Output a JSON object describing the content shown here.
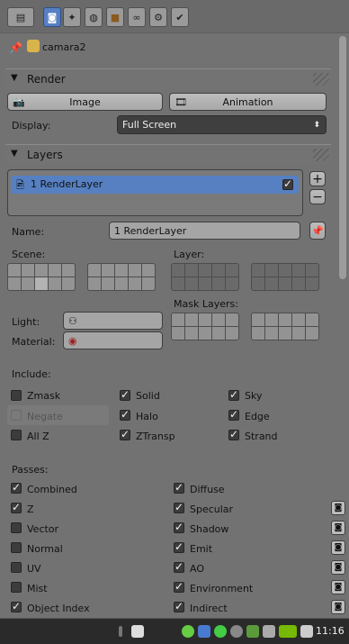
{
  "header": {
    "tabs": [
      {
        "icon": "editor-type-icon",
        "glyph": "▤"
      },
      {
        "icon": "camera-icon",
        "glyph": "◙"
      },
      {
        "icon": "scene-icon",
        "glyph": "✦"
      },
      {
        "icon": "world-icon",
        "glyph": "◍"
      },
      {
        "icon": "object-icon",
        "glyph": "■"
      },
      {
        "icon": "constraints-icon",
        "glyph": "∞"
      },
      {
        "icon": "modifiers-icon",
        "glyph": "⚙"
      },
      {
        "icon": "data-icon",
        "glyph": "✔"
      }
    ]
  },
  "context": {
    "name": "camara2"
  },
  "render": {
    "title": "Render",
    "image_button": "Image",
    "animation_button": "Animation",
    "display_label": "Display:",
    "display_value": "Full Screen"
  },
  "layers": {
    "title": "Layers",
    "list_item": "1 RenderLayer",
    "name_label": "Name:",
    "name_value": "1 RenderLayer",
    "scene_label": "Scene:",
    "layer_label": "Layer:",
    "mask_label": "Mask Layers:",
    "light_label": "Light:",
    "material_label": "Material:",
    "include_label": "Include:",
    "include": {
      "zmask": "Zmask",
      "negate": "Negate",
      "allz": "All Z",
      "solid": "Solid",
      "halo": "Halo",
      "ztransp": "ZTransp",
      "sky": "Sky",
      "edge": "Edge",
      "strand": "Strand"
    },
    "passes_label": "Passes:",
    "passes": {
      "combined": "Combined",
      "z": "Z",
      "vector": "Vector",
      "normal": "Normal",
      "uv": "UV",
      "mist": "Mist",
      "object_index": "Object Index",
      "diffuse": "Diffuse",
      "specular": "Specular",
      "shadow": "Shadow",
      "emit": "Emit",
      "ao": "AO",
      "environment": "Environment",
      "indirect": "Indirect"
    }
  },
  "taskbar": {
    "time": "11:16"
  },
  "colors": {
    "accent": "#5680c2",
    "panel": "#727272",
    "taskbar": "#2a2a2a"
  }
}
